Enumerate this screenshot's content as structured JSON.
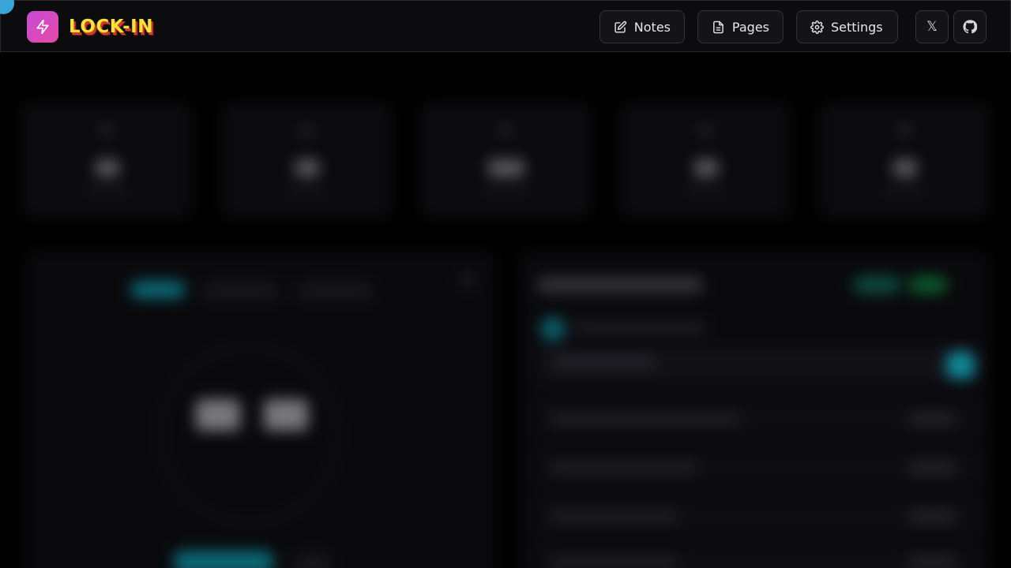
{
  "app": {
    "name": "LOCK-IN",
    "logo_icon": "bolt-icon",
    "brand_gradient": [
      "#c44bd6",
      "#e64aa6"
    ],
    "title_color": "#f8e13a",
    "title_shadow_color": "#d23b2e"
  },
  "header": {
    "nav": [
      {
        "label": "Notes",
        "icon": "edit-icon"
      },
      {
        "label": "Pages",
        "icon": "file-icon"
      },
      {
        "label": "Settings",
        "icon": "gear-icon"
      }
    ],
    "social": [
      {
        "label": "𝕏",
        "icon": "x-icon"
      },
      {
        "label": "",
        "icon": "github-icon"
      }
    ]
  },
  "colors": {
    "background": "#000000",
    "header_background": "#0c0c0e",
    "accent": "#14a3b8",
    "corner_dot": "#3aa6d8"
  }
}
